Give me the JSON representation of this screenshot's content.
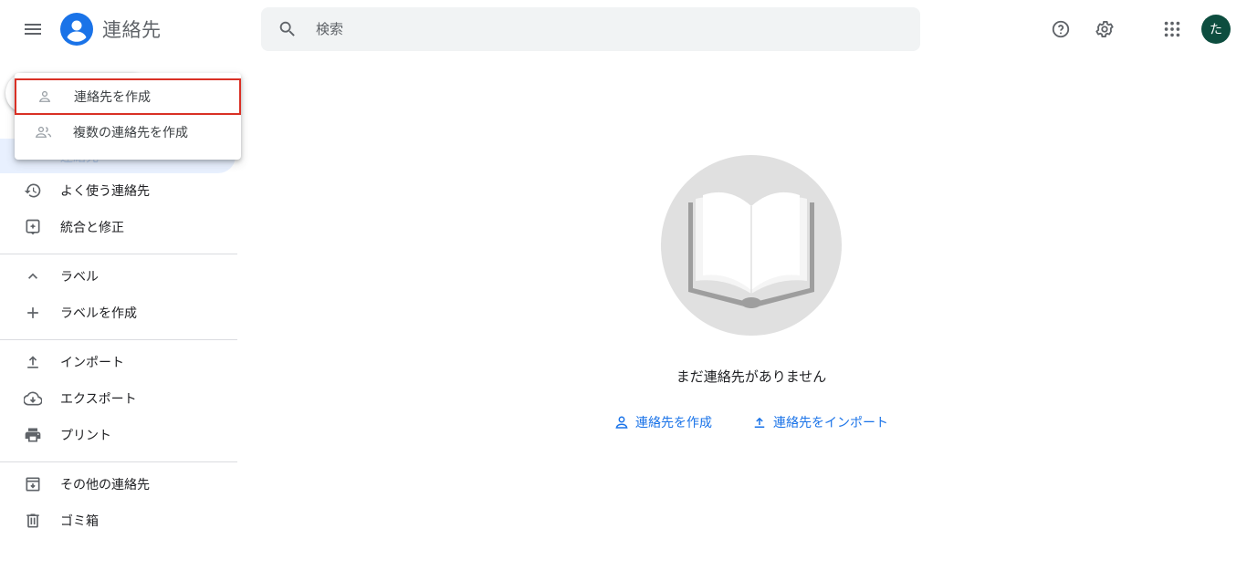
{
  "app": {
    "title": "連絡先"
  },
  "search": {
    "placeholder": "検索"
  },
  "header_icons": [
    "help-icon",
    "settings-icon",
    "apps-grid-icon"
  ],
  "user": {
    "avatar_initial": "た",
    "avatar_color": "#0d4d3f"
  },
  "create_menu": {
    "items": [
      {
        "label": "連絡先を作成",
        "icon": "person-outline-icon",
        "highlighted": true
      },
      {
        "label": "複数の連絡先を作成",
        "icon": "people-outline-icon",
        "highlighted": false
      }
    ]
  },
  "sidebar": {
    "contacts_partial": "連絡先",
    "items": [
      {
        "label": "よく使う連絡先",
        "icon": "history-icon"
      },
      {
        "label": "統合と修正",
        "icon": "merge-fix-icon"
      }
    ],
    "labels_section": {
      "label": "ラベル",
      "icon": "chevron-up-icon"
    },
    "create_label": {
      "label": "ラベルを作成",
      "icon": "plus-icon"
    },
    "tools": [
      {
        "label": "インポート",
        "icon": "upload-icon"
      },
      {
        "label": "エクスポート",
        "icon": "cloud-download-icon"
      },
      {
        "label": "プリント",
        "icon": "printer-icon"
      }
    ],
    "extra": [
      {
        "label": "その他の連絡先",
        "icon": "archive-icon"
      },
      {
        "label": "ゴミ箱",
        "icon": "trash-icon"
      }
    ]
  },
  "main": {
    "empty_message": "まだ連絡先がありません",
    "create_link": "連絡先を作成",
    "import_link": "連絡先をインポート"
  },
  "colors": {
    "accent": "#1a73e8",
    "highlight_border": "#d93025",
    "selected_bg": "#e8f0fe"
  }
}
